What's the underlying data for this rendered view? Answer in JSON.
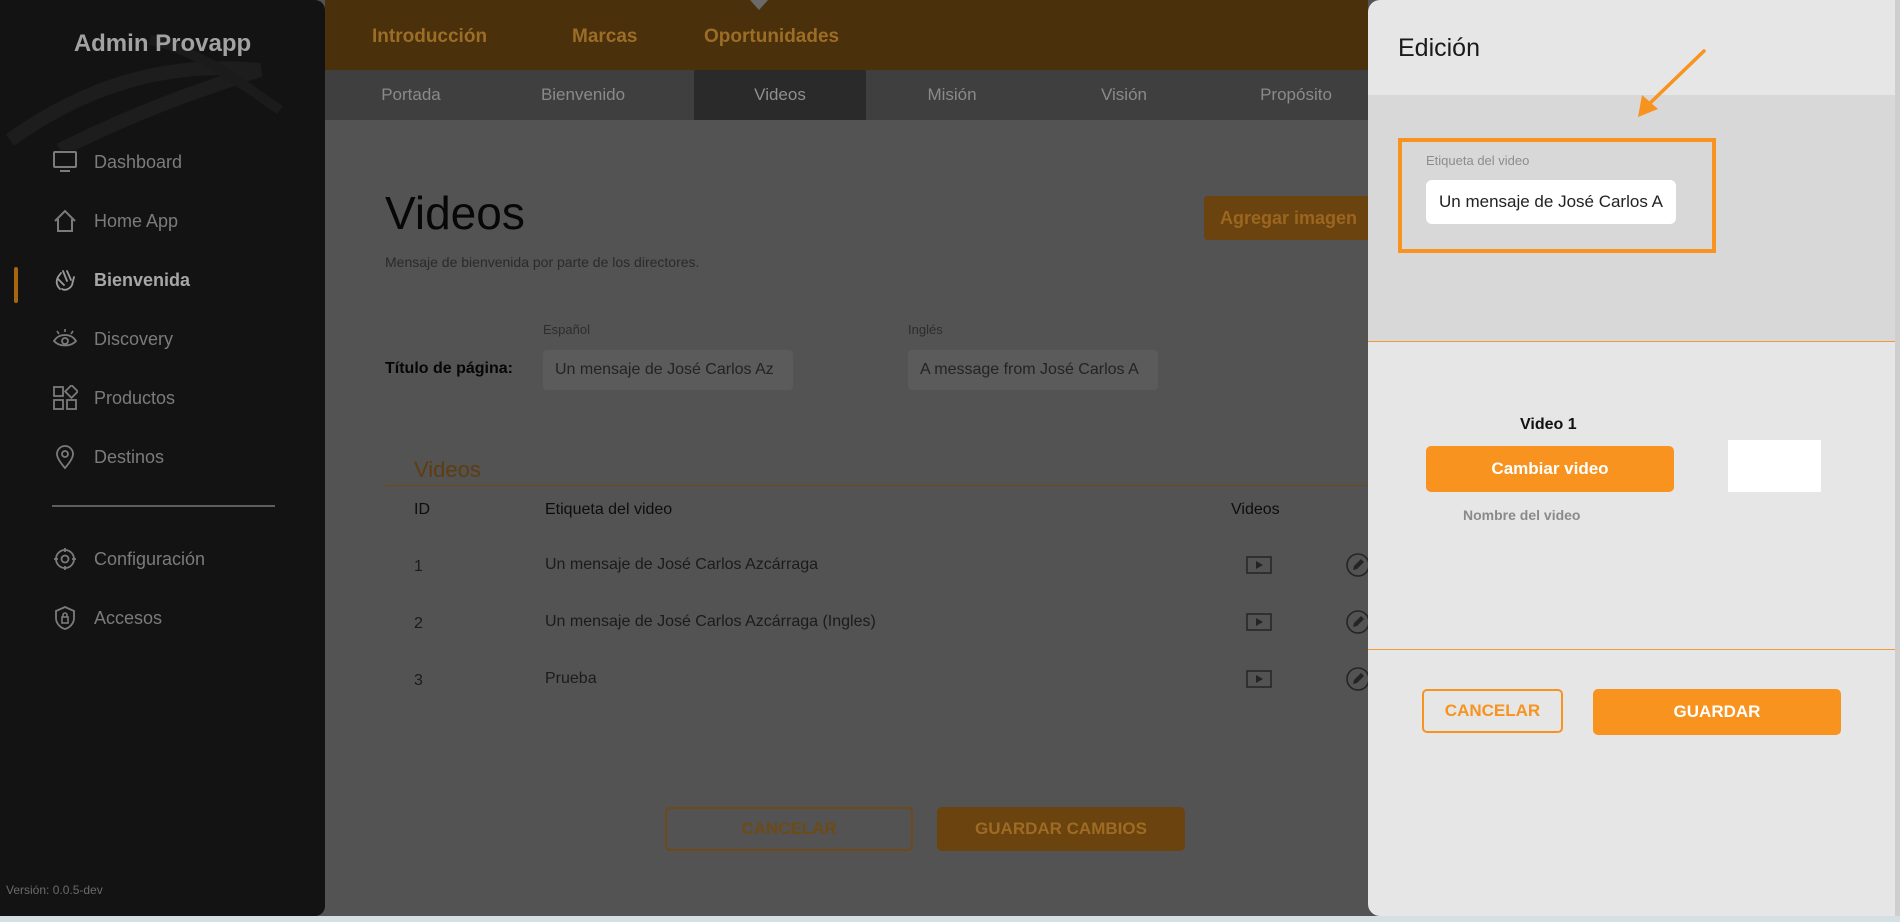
{
  "app": {
    "brand": "Admin Provapp",
    "version": "Versión: 0.0.5-dev"
  },
  "sidebar": {
    "items": [
      {
        "label": "Dashboard",
        "icon": "monitor-icon"
      },
      {
        "label": "Home App",
        "icon": "home-icon"
      },
      {
        "label": "Bienvenida",
        "icon": "waving-hand-icon",
        "active": true
      },
      {
        "label": "Discovery",
        "icon": "eye-icon"
      },
      {
        "label": "Productos",
        "icon": "grid-icon"
      },
      {
        "label": "Destinos",
        "icon": "map-pin-icon"
      },
      {
        "label": "Configuración",
        "icon": "gear-icon"
      },
      {
        "label": "Accesos",
        "icon": "shield-icon"
      }
    ]
  },
  "topnav": {
    "tabs": [
      "Introducción",
      "Marcas",
      "Oportunidades"
    ],
    "subtabs": [
      "Portada",
      "Bienvenido",
      "Videos",
      "Misión",
      "Visión",
      "Propósito"
    ],
    "active_subtab": "Videos"
  },
  "main": {
    "title": "Videos",
    "subtitle": "Mensaje de bienvenida por parte de los directores.",
    "add_button": "Agregar imagen",
    "lang_es": "Español",
    "lang_en": "Inglés",
    "title_label": "Título de página:",
    "title_es_value": "Un mensaje de José Carlos Az",
    "title_en_value": "A message from José Carlos A",
    "section_title": "Videos",
    "table": {
      "headers": [
        "ID",
        "Etiqueta del video",
        "Videos"
      ],
      "rows": [
        {
          "id": "1",
          "label": "Un mensaje de José Carlos Azcárraga"
        },
        {
          "id": "2",
          "label": "Un mensaje de José Carlos Azcárraga (Ingles)"
        },
        {
          "id": "3",
          "label": "Prueba"
        }
      ]
    },
    "cancel_button": "CANCELAR",
    "save_button": "GUARDAR CAMBIOS"
  },
  "panel": {
    "title": "Edición",
    "field_label": "Etiqueta del video",
    "field_value": "Un mensaje de José Carlos Az",
    "video_label": "Video 1",
    "change_button": "Cambiar video",
    "name_label": "Nombre del video",
    "cancel_button": "CANCELAR",
    "save_button": "GUARDAR"
  },
  "colors": {
    "accent": "#f7931e",
    "sidebar": "#131313",
    "overlay_bg": "#535353",
    "panel_bg": "#e6e6e6"
  }
}
